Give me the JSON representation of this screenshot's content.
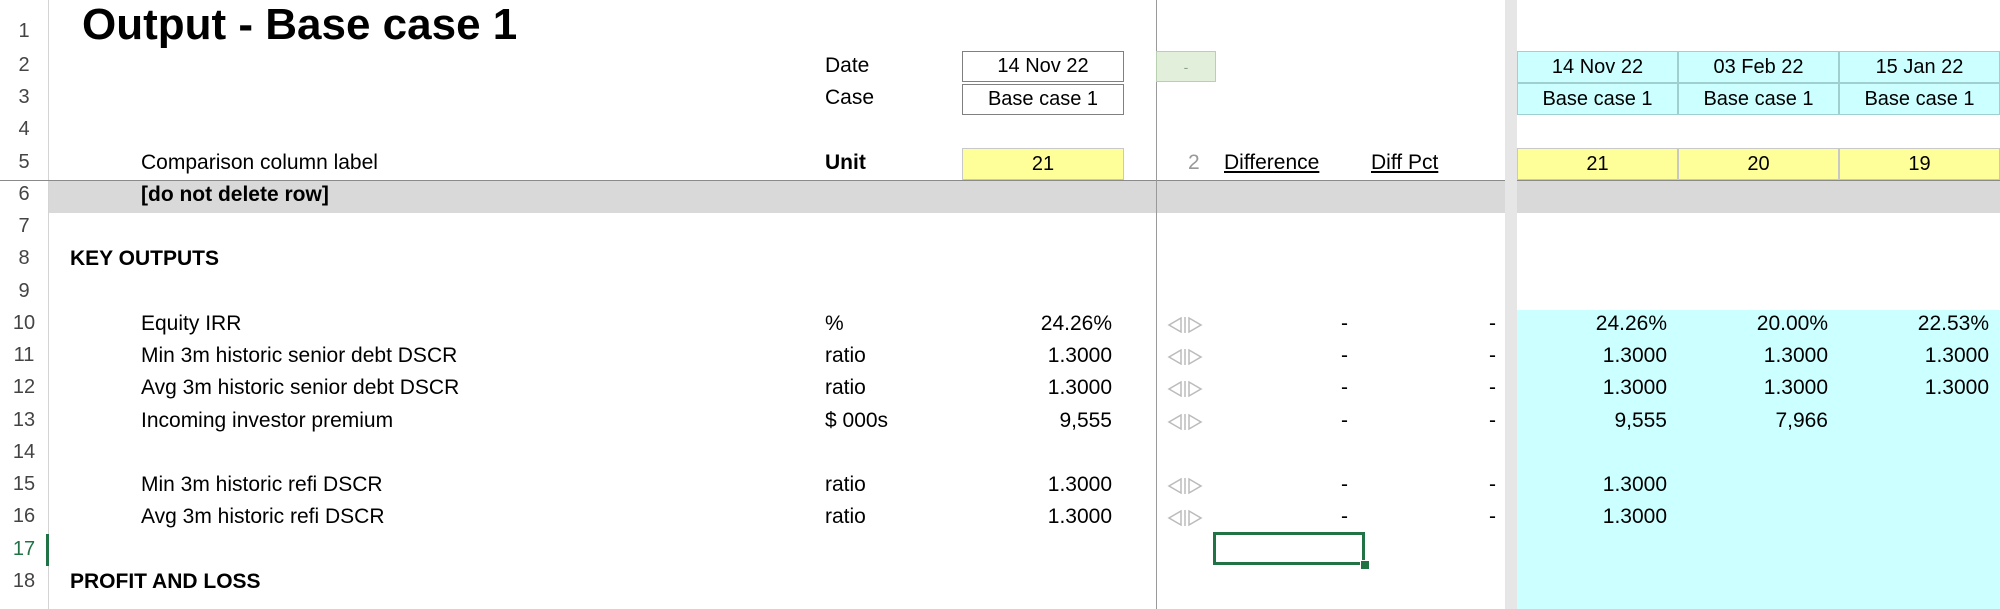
{
  "sheet": {
    "title": "Output - Base case 1",
    "row_numbers": [
      "1",
      "2",
      "3",
      "4",
      "5",
      "6",
      "7",
      "8",
      "9",
      "10",
      "11",
      "12",
      "13",
      "14",
      "15",
      "16",
      "17",
      "18"
    ],
    "header": {
      "date_label": "Date",
      "date_value": "14 Nov 22",
      "case_label": "Case",
      "case_value": "Base case 1",
      "small_flag": "-",
      "comparison_label": "Comparison column label",
      "unit_label": "Unit",
      "comparison_value": "21",
      "counter": "2",
      "difference_label": "Difference",
      "diffpct_label": "Diff Pct",
      "do_not_delete": "[do not delete row]"
    },
    "comparison_columns": [
      {
        "date": "14 Nov 22",
        "case": "Base case 1",
        "label": "21"
      },
      {
        "date": "03 Feb 22",
        "case": "Base case 1",
        "label": "20"
      },
      {
        "date": "15 Jan 22",
        "case": "Base case 1",
        "label": "19"
      }
    ],
    "sections": {
      "key_outputs": "KEY OUTPUTS",
      "profit_and_loss": "PROFIT AND LOSS"
    },
    "rows": [
      {
        "label": "Equity IRR",
        "unit": "%",
        "value": "24.26%",
        "diff": "-",
        "diffpct": "-",
        "cols": [
          "24.26%",
          "20.00%",
          "22.53%"
        ]
      },
      {
        "label": "Min 3m historic senior debt DSCR",
        "unit": "ratio",
        "value": "1.3000",
        "diff": "-",
        "diffpct": "-",
        "cols": [
          "1.3000",
          "1.3000",
          "1.3000"
        ]
      },
      {
        "label": "Avg 3m historic senior debt DSCR",
        "unit": "ratio",
        "value": "1.3000",
        "diff": "-",
        "diffpct": "-",
        "cols": [
          "1.3000",
          "1.3000",
          "1.3000"
        ]
      },
      {
        "label": "Incoming investor premium",
        "unit": "$ 000s",
        "value": "9,555",
        "diff": "-",
        "diffpct": "-",
        "cols": [
          "9,555",
          "7,966",
          ""
        ]
      },
      {
        "label": "Min 3m historic refi DSCR",
        "unit": "ratio",
        "value": "1.3000",
        "diff": "-",
        "diffpct": "-",
        "cols": [
          "1.3000",
          "",
          ""
        ]
      },
      {
        "label": "Avg 3m historic refi DSCR",
        "unit": "ratio",
        "value": "1.3000",
        "diff": "-",
        "diffpct": "-",
        "cols": [
          "1.3000",
          "",
          ""
        ]
      }
    ],
    "colors": {
      "yellow": "#ffff99",
      "cyan": "#ccffff",
      "selection": "#217346",
      "band": "#d9d9d9"
    }
  }
}
